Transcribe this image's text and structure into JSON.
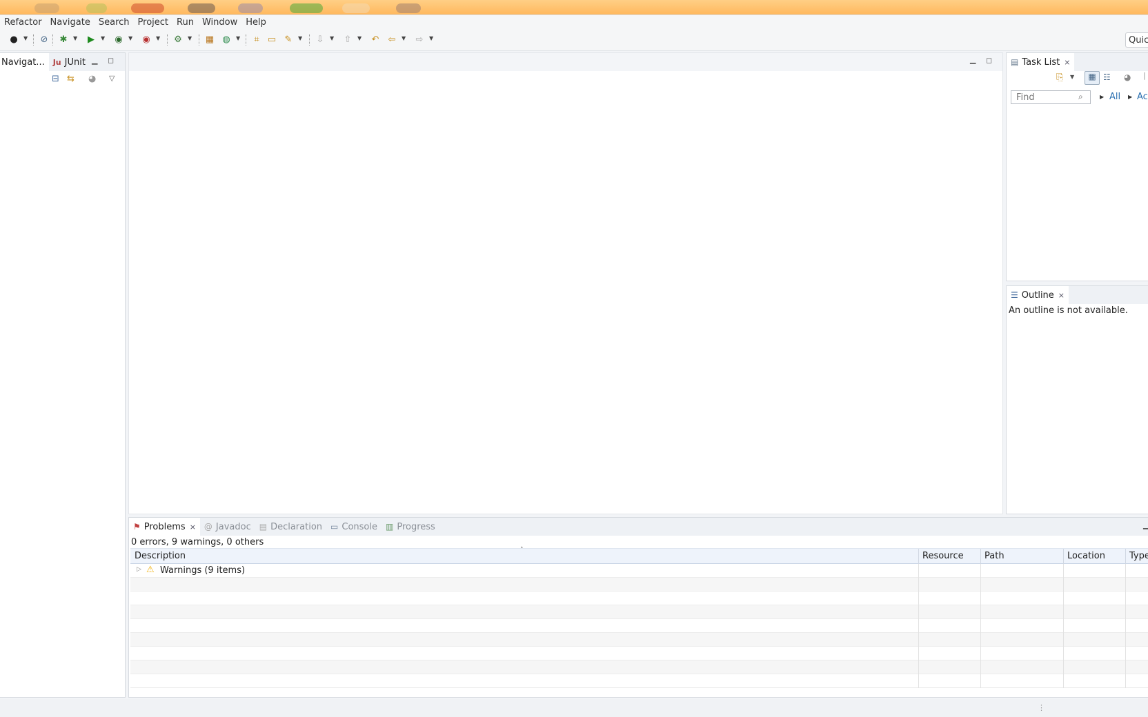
{
  "menu": [
    "Refactor",
    "Navigate",
    "Search",
    "Project",
    "Run",
    "Window",
    "Help"
  ],
  "quick_access": "Quick",
  "left_panel": {
    "tabs": [
      {
        "label": "Navigat...",
        "icon": "navigator-icon"
      },
      {
        "label": "JUnit",
        "icon": "junit-icon",
        "icon_text": "Ju"
      }
    ]
  },
  "task_list": {
    "tab_label": "Task List",
    "find_placeholder": "Find",
    "filter_all": "All",
    "filter_activate": "Ac"
  },
  "outline": {
    "tab_label": "Outline",
    "message": "An outline is not available."
  },
  "bottom_panel": {
    "tabs": [
      {
        "label": "Problems",
        "active": true
      },
      {
        "label": "Javadoc",
        "active": false
      },
      {
        "label": "Declaration",
        "active": false
      },
      {
        "label": "Console",
        "active": false
      },
      {
        "label": "Progress",
        "active": false
      }
    ],
    "summary": "0 errors, 9 warnings, 0 others",
    "columns": [
      "Description",
      "Resource",
      "Path",
      "Location",
      "Type"
    ],
    "rows": [
      {
        "description": "Warnings (9 items)",
        "kind": "warning-group"
      }
    ]
  },
  "colors": {
    "accent": "#2a6fb0",
    "warning": "#f1b417",
    "panel_border": "#d7dbe0"
  }
}
